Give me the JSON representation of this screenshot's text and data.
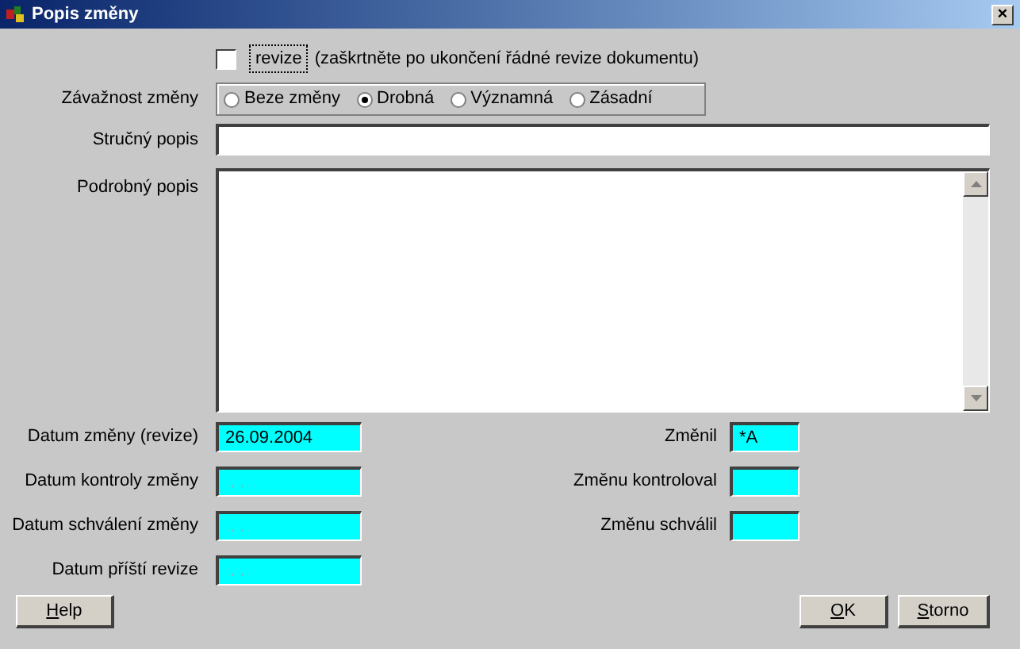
{
  "window": {
    "title": "Popis změny",
    "close": "×"
  },
  "revize": {
    "label": "revize",
    "checked": false,
    "hint": "(zaškrtněte po ukončení řádné revize dokumentu)"
  },
  "severity": {
    "label": "Závažnost změny",
    "options": [
      {
        "label": "Beze změny",
        "selected": false
      },
      {
        "label": "Drobná",
        "selected": true
      },
      {
        "label": "Významná",
        "selected": false
      },
      {
        "label": "Zásadní",
        "selected": false
      }
    ]
  },
  "short_description": {
    "label": "Stručný popis"
  },
  "long_description": {
    "label": "Podrobný popis"
  },
  "dates": [
    {
      "label": "Datum změny (revize)",
      "value": "26.09.2004"
    },
    {
      "label": "Datum kontroly změny",
      "placeholder": " . ."
    },
    {
      "label": "Datum schválení změny",
      "placeholder": " . ."
    },
    {
      "label": "Datum příští revize",
      "placeholder": " . ."
    }
  ],
  "people": [
    {
      "label": "Změnil",
      "value": "*A"
    },
    {
      "label": "Změnu kontroloval"
    },
    {
      "label": "Změnu schválil"
    }
  ],
  "buttons": {
    "help": "Help",
    "ok": "OK",
    "cancel": "Storno"
  }
}
